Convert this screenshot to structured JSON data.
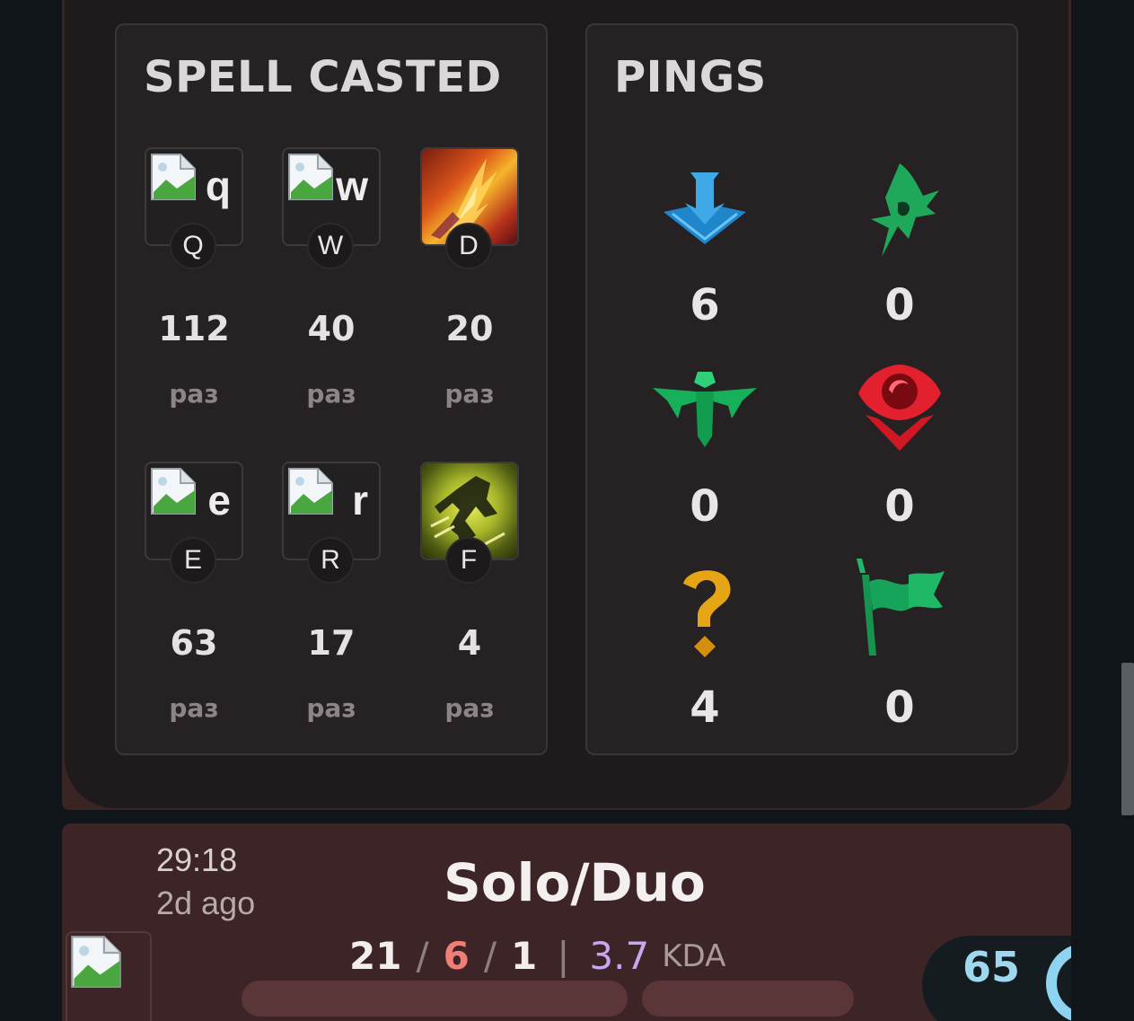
{
  "spells": {
    "title": "SPELL CASTED",
    "items": [
      {
        "key": "Q",
        "alt": "q",
        "count": "112",
        "unit": "раз",
        "icon": "broken-image-icon"
      },
      {
        "key": "W",
        "alt": "w",
        "count": "40",
        "unit": "раз",
        "icon": "broken-image-icon"
      },
      {
        "key": "D",
        "alt": "",
        "count": "20",
        "unit": "раз",
        "icon": "ignite-spell-icon"
      },
      {
        "key": "E",
        "alt": "e",
        "count": "63",
        "unit": "раз",
        "icon": "broken-image-icon"
      },
      {
        "key": "R",
        "alt": "r",
        "count": "17",
        "unit": "раз",
        "icon": "broken-image-icon"
      },
      {
        "key": "F",
        "alt": "",
        "count": "4",
        "unit": "раз",
        "icon": "ghost-spell-icon"
      }
    ]
  },
  "pings": {
    "title": "PINGS",
    "items": [
      {
        "icon": "on-my-way-ping-icon",
        "count": "6",
        "color": "#2a9fe0"
      },
      {
        "icon": "assist-me-ping-icon",
        "count": "0",
        "color": "#17b05a"
      },
      {
        "icon": "need-vision-ping-icon",
        "count": "0",
        "color": "#17b05a"
      },
      {
        "icon": "enemy-vision-ping-icon",
        "count": "0",
        "color": "#e2202e"
      },
      {
        "icon": "enemy-missing-ping-icon",
        "count": "4",
        "color": "#e6a515"
      },
      {
        "icon": "push-ping-icon",
        "count": "0",
        "color": "#17a35a"
      }
    ]
  },
  "match": {
    "duration": "29:18",
    "ago": "2d ago",
    "queue": "Solo/Duo",
    "kills": "21",
    "deaths": "6",
    "assists": "1",
    "kda_ratio": "3.7",
    "kda_label": "KDA",
    "score": "65"
  }
}
